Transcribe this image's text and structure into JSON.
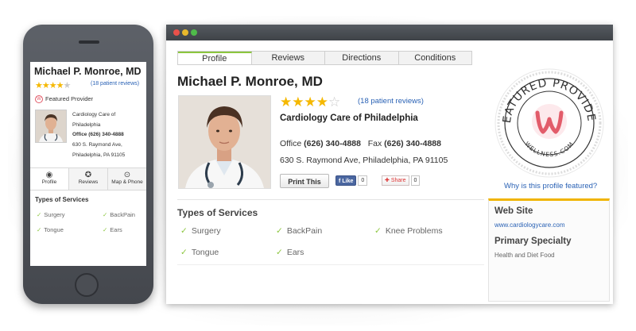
{
  "doctor": {
    "name": "Michael P. Monroe, MD",
    "rating_stars": 4,
    "rating_max": 5,
    "reviews": "(18 patient reviews)",
    "practice": "Cardiology Care of Philadelphia",
    "office_label": "Office",
    "office_phone": "(626) 340-4888",
    "fax_label": "Fax",
    "fax_phone": "(626) 340-4888",
    "address_full": "630 S. Raymond Ave, Philadelphia, PA  91105",
    "address_line1": "630 S. Raymond Ave,",
    "address_line2": "Philadelphia, PA  91105"
  },
  "mobile": {
    "featured_label": "Featured Provider",
    "practice_line1": "Cardiology Care of",
    "practice_line2": "Philadelphia",
    "tabs": [
      {
        "label": "Profile",
        "icon": "user-icon"
      },
      {
        "label": "Reviews",
        "icon": "star-icon"
      },
      {
        "label": "Map & Phone",
        "icon": "map-pin-icon"
      }
    ],
    "types_title": "Types of Services",
    "services": [
      "Surgery",
      "BackPain",
      "Tongue",
      "Ears"
    ]
  },
  "desktop": {
    "tabs": [
      "Profile",
      "Reviews",
      "Directions",
      "Conditions"
    ],
    "active_tab": "Profile",
    "print_label": "Print This",
    "like_label": "Like",
    "like_count": "0",
    "share_label": "Share",
    "share_count": "0",
    "types_title": "Types of Services",
    "services": [
      "Surgery",
      "BackPain",
      "Knee Problems",
      "Tongue",
      "Ears"
    ],
    "why_link": "Why is this profile featured?",
    "badge_text": "FEATURED PROVIDER",
    "badge_brand": "WELLNESS.COM",
    "website_title": "Web Site",
    "website_url": "www.cardiologycare.com",
    "specialty_title": "Primary Specialty",
    "specialty_value": "Health and Diet Food"
  },
  "colors": {
    "accent_green": "#8cc63f",
    "star_gold": "#f5b800",
    "link_blue": "#2a62b5",
    "badge_pink": "#e25c6a",
    "side_accent": "#f0b400"
  }
}
